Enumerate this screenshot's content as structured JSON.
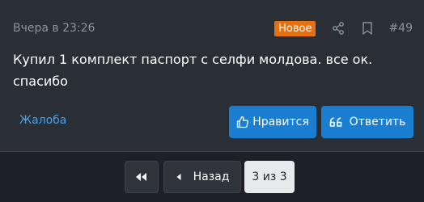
{
  "post": {
    "date": "Вчера в 23:26",
    "badge": "Новое",
    "number": "#49",
    "body": "Купил 1 комплект паспорт с селфи молдова. все ок. спасибо",
    "report_label": "Жалоба",
    "like_label": "Нравится",
    "reply_label": "Ответить",
    "icons": {
      "share": "share-icon",
      "bookmark": "bookmark-icon",
      "like": "thumbs-up-icon",
      "reply": "quote-icon"
    }
  },
  "pagination": {
    "prev_label": "Назад",
    "current": "3 из 3",
    "first_icon": "double-chevron-left-icon",
    "prev_icon": "caret-left-icon"
  },
  "colors": {
    "background": "#1d2127",
    "card": "#2a2e35",
    "badge": "#e8710f",
    "accent_blue": "#1a7fd0",
    "link_blue": "#4aa3e8",
    "muted_text": "#8e949c"
  }
}
